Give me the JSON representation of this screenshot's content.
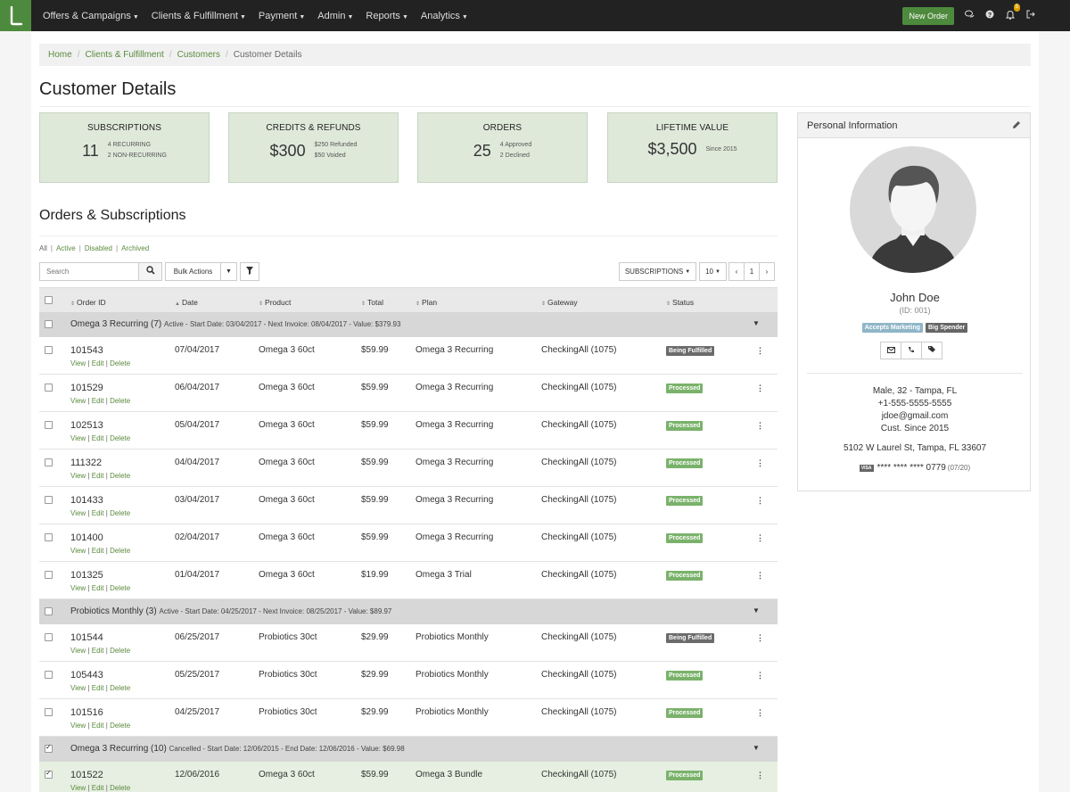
{
  "nav": {
    "menu": [
      {
        "label": "Offers & Campaigns"
      },
      {
        "label": "Clients & Fulfillment"
      },
      {
        "label": "Payment"
      },
      {
        "label": "Admin"
      },
      {
        "label": "Reports"
      },
      {
        "label": "Analytics"
      }
    ],
    "new_order_label": "New Order",
    "notification_count": "5"
  },
  "breadcrumb": {
    "items": [
      "Home",
      "Clients & Fulfillment",
      "Customers"
    ],
    "current": "Customer Details"
  },
  "page_title": "Customer Details",
  "stats": [
    {
      "title": "SUBSCRIPTIONS",
      "value": "11",
      "sub1": "4 RECURRING",
      "sub2": "2 NON-RECURRING"
    },
    {
      "title": "CREDITS & REFUNDS",
      "value": "$300",
      "sub1": "$250 Refunded",
      "sub2": "$50 Voided"
    },
    {
      "title": "ORDERS",
      "value": "25",
      "sub1": "4 Approved",
      "sub2": "2 Declined"
    },
    {
      "title": "LIFETIME VALUE",
      "value": "$3,500",
      "sub1": "Since 2015",
      "sub2": ""
    }
  ],
  "orders": {
    "title": "Orders & Subscriptions",
    "filters": [
      "All",
      "Active",
      "Disabled",
      "Archived"
    ],
    "search_placeholder": "Search",
    "bulk_actions_label": "Bulk Actions",
    "subscriptions_dropdown": "SUBSCRIPTIONS",
    "per_page": "10",
    "page": "1",
    "prev_symbol": "‹",
    "next_symbol": "›",
    "columns": [
      "Order ID",
      "Date",
      "Product",
      "Total",
      "Plan",
      "Gateway",
      "Status"
    ],
    "row_link_view": "View",
    "row_link_edit": "Edit",
    "row_link_delete": "Delete",
    "groups": [
      {
        "name": "Omega 3 Recurring (7)",
        "meta": "Active - Start Date: 03/04/2017 - Next Invoice: 08/04/2017 - Value: $379.93",
        "checked": false,
        "rows": [
          {
            "id": "101543",
            "date": "07/04/2017",
            "product": "Omega 3 60ct",
            "total": "$59.99",
            "plan": "Omega 3 Recurring",
            "gateway": "CheckingAll (1075)",
            "status": "Being Fulfilled",
            "checked": false
          },
          {
            "id": "101529",
            "date": "06/04/2017",
            "product": "Omega 3 60ct",
            "total": "$59.99",
            "plan": "Omega 3 Recurring",
            "gateway": "CheckingAll (1075)",
            "status": "Processed",
            "checked": false
          },
          {
            "id": "102513",
            "date": "05/04/2017",
            "product": "Omega 3 60ct",
            "total": "$59.99",
            "plan": "Omega 3 Recurring",
            "gateway": "CheckingAll (1075)",
            "status": "Processed",
            "checked": false
          },
          {
            "id": "111322",
            "date": "04/04/2017",
            "product": "Omega 3 60ct",
            "total": "$59.99",
            "plan": "Omega 3 Recurring",
            "gateway": "CheckingAll (1075)",
            "status": "Processed",
            "checked": false
          },
          {
            "id": "101433",
            "date": "03/04/2017",
            "product": "Omega 3 60ct",
            "total": "$59.99",
            "plan": "Omega 3 Recurring",
            "gateway": "CheckingAll (1075)",
            "status": "Processed",
            "checked": false
          },
          {
            "id": "101400",
            "date": "02/04/2017",
            "product": "Omega 3 60ct",
            "total": "$59.99",
            "plan": "Omega 3 Recurring",
            "gateway": "CheckingAll (1075)",
            "status": "Processed",
            "checked": false
          },
          {
            "id": "101325",
            "date": "01/04/2017",
            "product": "Omega 3 60ct",
            "total": "$19.99",
            "plan": "Omega 3 Trial",
            "gateway": "CheckingAll (1075)",
            "status": "Processed",
            "checked": false
          }
        ]
      },
      {
        "name": "Probiotics Monthly (3)",
        "meta": "Active - Start Date: 04/25/2017 - Next Invoice: 08/25/2017 - Value: $89.97",
        "checked": false,
        "rows": [
          {
            "id": "101544",
            "date": "06/25/2017",
            "product": "Probiotics 30ct",
            "total": "$29.99",
            "plan": "Probiotics Monthly",
            "gateway": "CheckingAll (1075)",
            "status": "Being Fulfilled",
            "checked": false
          },
          {
            "id": "105443",
            "date": "05/25/2017",
            "product": "Probiotics 30ct",
            "total": "$29.99",
            "plan": "Probiotics Monthly",
            "gateway": "CheckingAll (1075)",
            "status": "Processed",
            "checked": false
          },
          {
            "id": "101516",
            "date": "04/25/2017",
            "product": "Probiotics 30ct",
            "total": "$29.99",
            "plan": "Probiotics Monthly",
            "gateway": "CheckingAll (1075)",
            "status": "Processed",
            "checked": false
          }
        ]
      },
      {
        "name": "Omega 3 Recurring (10)",
        "meta": "Cancelled - Start Date: 12/06/2015 - End Date: 12/06/2016 - Value: $69.98",
        "checked": true,
        "rows": [
          {
            "id": "101522",
            "date": "12/06/2016",
            "product": "Omega 3 60ct",
            "total": "$59.99",
            "plan": "Omega 3 Bundle",
            "gateway": "CheckingAll (1075)",
            "status": "Processed",
            "checked": true
          }
        ]
      }
    ]
  },
  "personal": {
    "title": "Personal Information",
    "name": "John Doe",
    "id_text": "(ID: 001)",
    "tags": [
      "Accepts Marketing",
      "Big Spender"
    ],
    "demographics": "Male, 32 - Tampa, FL",
    "phone": "+1-555-5555-5555",
    "email": "jdoe@gmail.com",
    "since": "Cust. Since 2015",
    "address": "5102 W Laurel St, Tampa, FL 33607",
    "card_brand": "VISA",
    "card_number": "**** **** **** 0779",
    "card_exp": "(07/20)"
  },
  "colors": {
    "brand_green": "#4e8a3d",
    "status_processed": "#7ab26b",
    "status_fulfilled": "#6b6b6b"
  }
}
